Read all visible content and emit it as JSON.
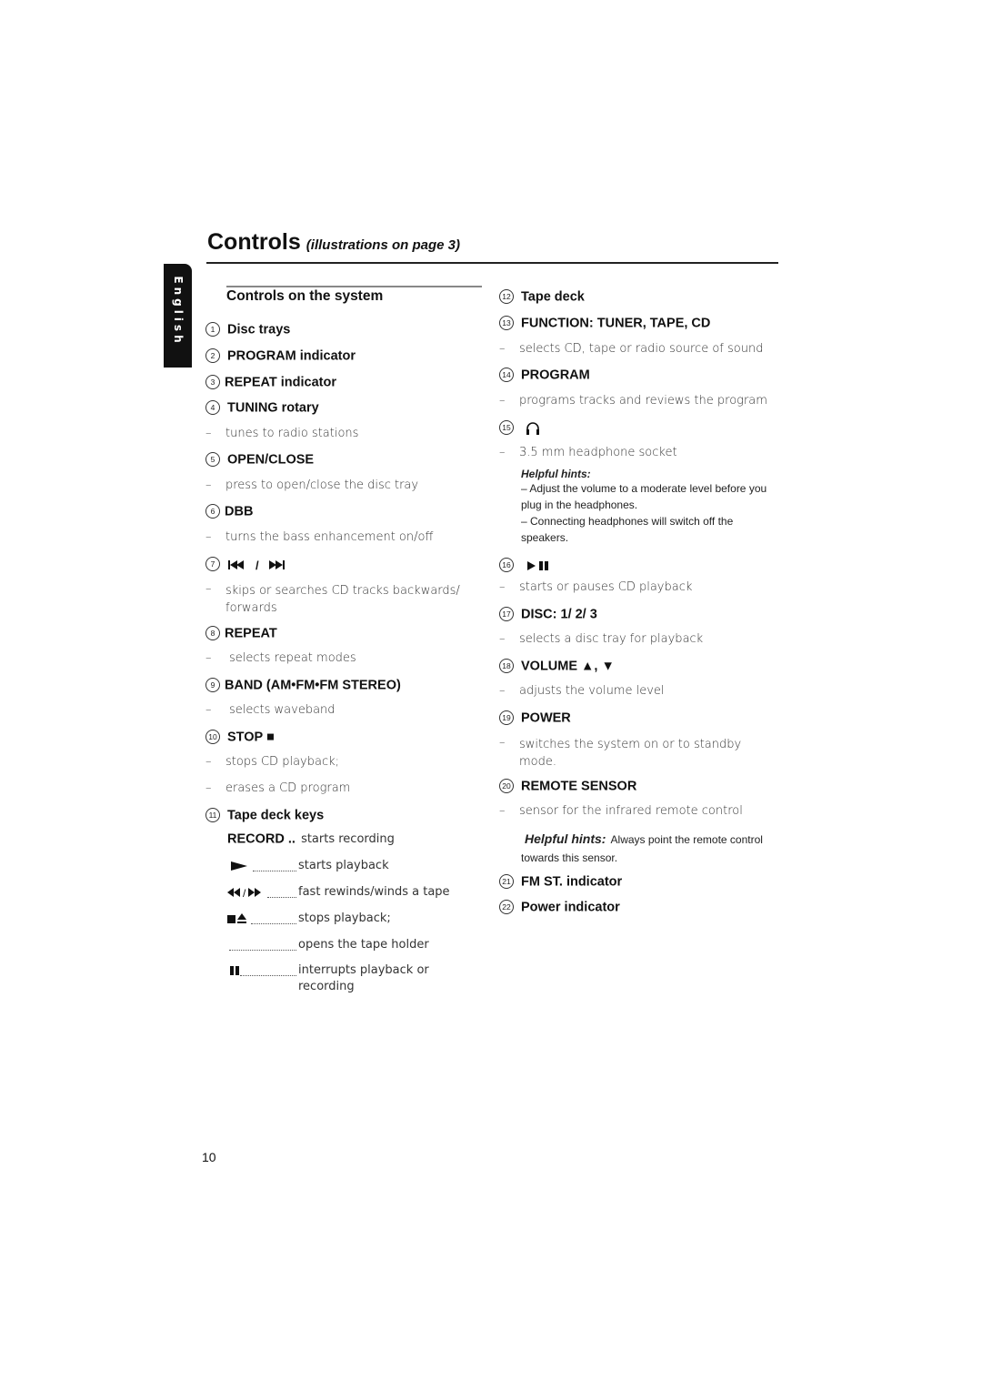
{
  "page": {
    "title": "Controls",
    "subtitle": "(illustrations on page 3)",
    "language_tab": "English",
    "page_number": "10"
  },
  "section": {
    "title": "Controls on the system"
  },
  "left_items": [
    {
      "num": "1",
      "label": "Disc trays"
    },
    {
      "num": "2",
      "label": "PROGRAM indicator"
    },
    {
      "num": "3",
      "label": "REPEAT indicator"
    },
    {
      "num": "4",
      "label": "TUNING rotary",
      "desc": [
        "tunes to radio stations"
      ]
    },
    {
      "num": "5",
      "label": "OPEN/CLOSE",
      "desc": [
        "press to open/close  the disc tray"
      ]
    },
    {
      "num": "6",
      "label": "DBB",
      "desc": [
        "turns the bass enhancement on/off"
      ]
    },
    {
      "num": "7",
      "label": "⧏◀◀  /  ▶▶⧐",
      "icon": "skip-back-forward-icon",
      "desc": [
        "skips or searches CD tracks backwards/ forwards"
      ]
    },
    {
      "num": "8",
      "label": "REPEAT",
      "desc": [
        "selects repeat modes"
      ]
    },
    {
      "num": "9",
      "label": "BAND (AM•FM•FM STEREO)",
      "desc": [
        "selects waveband"
      ]
    },
    {
      "num": "10",
      "label": "STOP ■",
      "icon": "stop-icon",
      "desc": [
        "stops CD playback;",
        "erases a CD program"
      ]
    },
    {
      "num": "11",
      "label": "Tape deck keys"
    }
  ],
  "tape_keys": [
    {
      "key": "RECORD ..",
      "icon": "record-text",
      "desc": "starts recording"
    },
    {
      "key": "▶",
      "icon": "play-icon",
      "desc": "starts playback"
    },
    {
      "key": "◀◀ /▶▶",
      "icon": "rewind-forward-icon",
      "desc": "fast rewinds/winds a tape"
    },
    {
      "key": "■⏏",
      "icon": "stop-eject-icon",
      "desc": "stops playback;"
    },
    {
      "key": "",
      "icon": "",
      "desc": "opens the tape holder"
    },
    {
      "key": "❚❚",
      "icon": "pause-icon",
      "desc": "interrupts playback or recording"
    }
  ],
  "right_items": [
    {
      "num": "12",
      "label": "Tape deck"
    },
    {
      "num": "13",
      "label": "FUNCTION: TUNER, TAPE, CD",
      "desc": [
        "selects CD, tape or radio source of sound"
      ]
    },
    {
      "num": "14",
      "label": "PROGRAM",
      "desc": [
        "programs tracks and reviews the program"
      ]
    },
    {
      "num": "15",
      "label": "",
      "icon": "headphones-icon",
      "desc": [
        "3.5 mm headphone socket"
      ],
      "hints": {
        "title": "Helpful hints:",
        "lines": [
          "– Adjust the volume to a moderate level before you plug in the headphones.",
          "– Connecting headphones will switch off the speakers."
        ]
      }
    },
    {
      "num": "16",
      "label": "▶❚❚",
      "icon": "play-pause-icon",
      "desc": [
        "starts or pauses CD playback"
      ]
    },
    {
      "num": "17",
      "label": "DISC: 1/ 2/ 3",
      "desc": [
        "selects a disc tray for playback"
      ]
    },
    {
      "num": "18",
      "label": "VOLUME ▲, ▼",
      "icon": "volume-up-down-icon",
      "desc": [
        "adjusts the volume level"
      ]
    },
    {
      "num": "19",
      "label": "POWER",
      "desc": [
        "switches the system on or to standby mode."
      ]
    },
    {
      "num": "20",
      "label": "REMOTE SENSOR",
      "desc": [
        "sensor for the infrared remote control"
      ],
      "hints": {
        "title": "Helpful hints:",
        "text": "Always point the remote control towards this sensor."
      }
    },
    {
      "num": "21",
      "label": "FM ST. indicator"
    },
    {
      "num": "22",
      "label": "Power indicator"
    }
  ]
}
